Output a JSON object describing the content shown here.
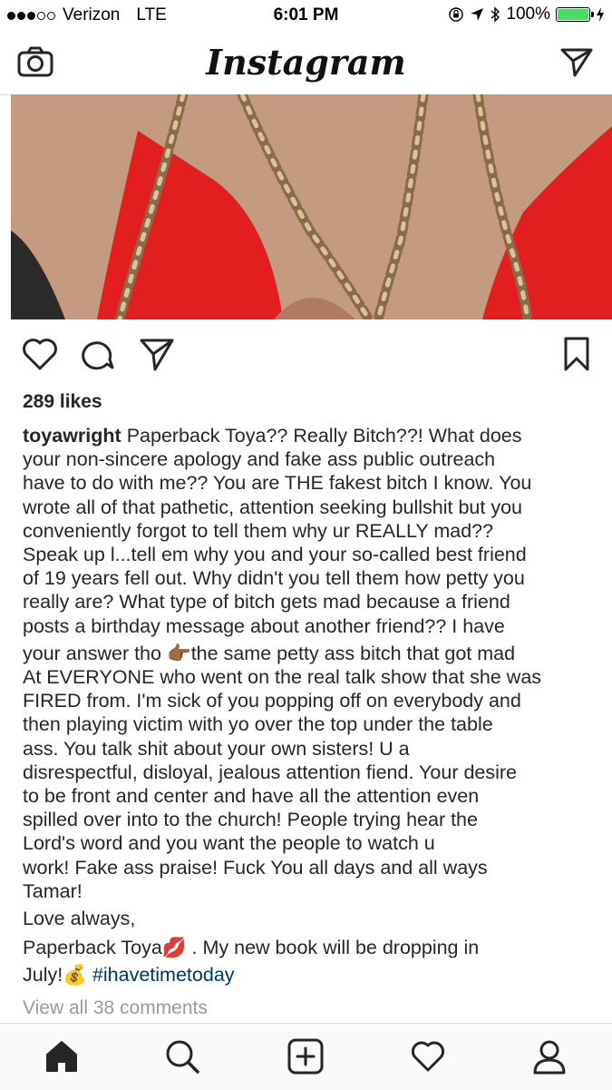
{
  "status_bar": {
    "carrier": "Verizon",
    "network": "LTE",
    "time": "6:01 PM",
    "battery": "100%",
    "signal_bars_filled": 3,
    "signal_bars_total": 5,
    "battery_color": "#4cd964"
  },
  "nav": {
    "title": "Instagram",
    "left_icon": "camera-icon",
    "right_icon": "direct-message-icon"
  },
  "post": {
    "image_description_icon": "post-photo",
    "actions": [
      "heart-icon",
      "comment-icon",
      "share-icon",
      "bookmark-icon"
    ],
    "likes": "289 likes",
    "username": "toyawright",
    "caption_lines": [
      "your non-sincere apology and fake ass public outreach",
      "have to do with me?? You are THE fakest bitch I know.  You",
      "wrote all of that pathetic, attention seeking bullshit but you",
      "conveniently forgot to tell them why ur REALLY mad??",
      "Speak up l...tell em why you and your so-called best friend",
      "of 19 years fell out.  Why didn't you tell them how petty you",
      "really are?  What type of bitch gets mad because a friend",
      "posts a birthday message about another friend?? I have",
      "your answer tho 👉🏾the same petty ass bitch that got mad",
      "At EVERYONE who went on the real talk show that she was",
      "FIRED from.  I'm sick of you popping off on everybody and",
      "then playing victim with yo over the top under the table",
      "ass.  You talk shit about your own sisters!  U a",
      "disrespectful, disloyal, jealous attention fiend. Your desire",
      "to be front and center and have all the attention even",
      "spilled over into to the church! People trying hear the",
      "Lord's word and you want the people to watch u",
      "work!  Fake ass praise! Fuck You all days and all ways",
      "Tamar!"
    ],
    "caption_first_line": "Paperback Toya?? Really Bitch??! What does",
    "signoff": "Love always,",
    "signature_line": "Paperback Toya💋 . My new book will be dropping in",
    "last_line_text": "July!💰 ",
    "hashtag": "#ihavetimetoday",
    "hashtag_color": "#003569",
    "view_comments": "View all 38 comments"
  },
  "tab_bar": {
    "tabs": [
      "home-icon",
      "search-icon",
      "new-post-icon",
      "activity-icon",
      "profile-icon"
    ],
    "active": "home-icon"
  }
}
